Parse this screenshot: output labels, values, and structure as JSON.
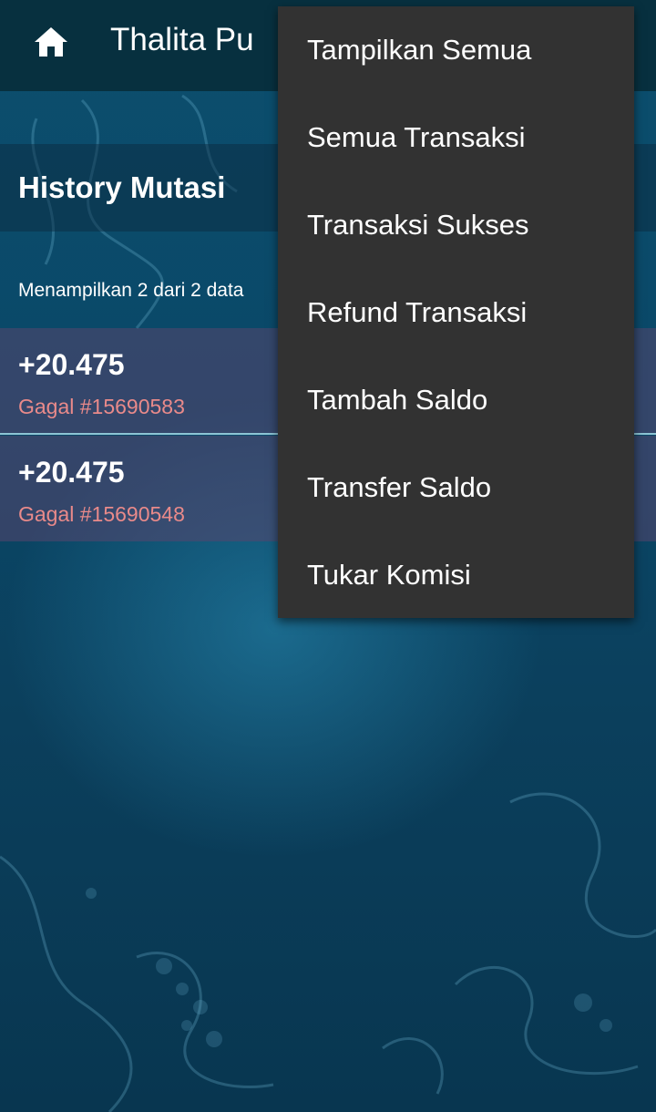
{
  "header": {
    "title": "Thalita Pu",
    "home_icon": "home-icon"
  },
  "section": {
    "title": "History Mutasi",
    "count_text": "Menampilkan 2 dari 2 data"
  },
  "transactions": [
    {
      "amount": "+20.475",
      "status": "Gagal #15690583"
    },
    {
      "amount": "+20.475",
      "status": "Gagal #15690548"
    }
  ],
  "menu": {
    "items": [
      "Tampilkan Semua",
      "Semua Transaksi",
      "Transaksi Sukses",
      "Refund Transaksi",
      "Tambah Saldo",
      "Transfer Saldo",
      "Tukar Komisi"
    ]
  },
  "colors": {
    "topbar": "#07303f",
    "menu_bg": "#323232",
    "status_failed": "#e98a8a",
    "divider": "#8cc4d4"
  }
}
